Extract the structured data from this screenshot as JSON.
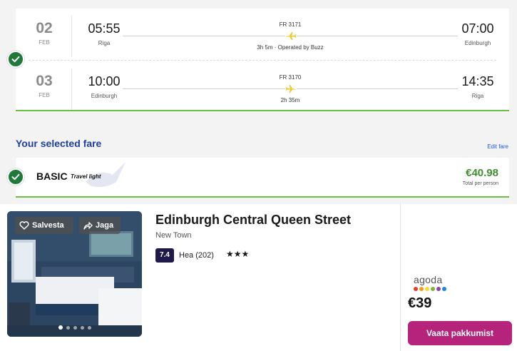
{
  "flights": {
    "outbound": {
      "day": "02",
      "month": "FEB",
      "dep_time": "05:55",
      "dep_city": "Riga",
      "flight_no": "FR 3171",
      "duration": "3h 5m · Operated by Buzz",
      "arr_time": "07:00",
      "arr_city": "Edinburgh"
    },
    "inbound": {
      "day": "03",
      "month": "FEB",
      "dep_time": "10:00",
      "dep_city": "Edinburgh",
      "flight_no": "FR 3170",
      "duration": "2h 35m",
      "arr_time": "14:35",
      "arr_city": "Riga"
    }
  },
  "fare": {
    "heading": "Your selected fare",
    "edit_label": "Edit fare",
    "name": "BASIC",
    "subtitle": "Travel light",
    "price": "€40.98",
    "price_note": "Total per person"
  },
  "hotel": {
    "save_label": "Salvesta",
    "share_label": "Jaga",
    "name": "Edinburgh Central Queen Street",
    "area": "New Town",
    "score": "7.4",
    "score_text": "Hea (202)",
    "stars": "★★★",
    "star_count": 3,
    "photo_count": 5,
    "active_photo": 1,
    "provider": "agoda",
    "price": "€39",
    "cta_label": "Vaata pakkumist"
  },
  "colors": {
    "accent_green": "#6dbd47",
    "check_green": "#1f7a3a",
    "fare_heading_blue": "#1e3f9c",
    "price_green": "#3f8f2f",
    "cta_magenta": "#b5237a",
    "score_bg": "#1f1a4a",
    "plane_yellow": "#f1c933"
  },
  "icons": {
    "check": "check-icon",
    "plane": "plane-icon",
    "heart": "heart-icon",
    "share": "share-icon"
  }
}
